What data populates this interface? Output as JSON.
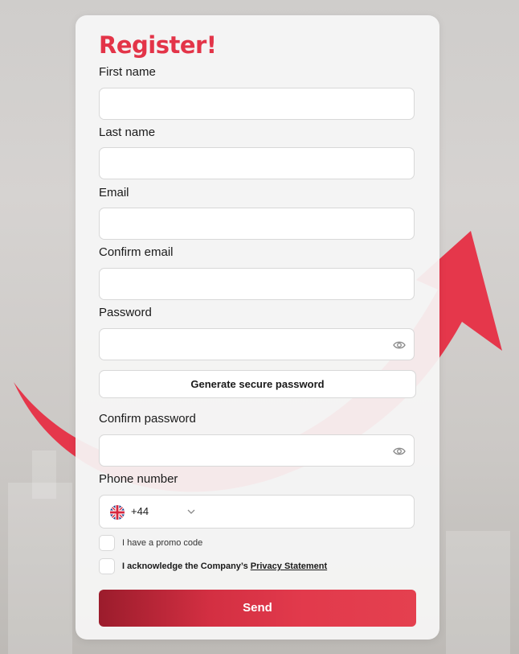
{
  "form": {
    "title": "Register!",
    "first_name_label": "First name",
    "last_name_label": "Last name",
    "email_label": "Email",
    "confirm_email_label": "Confirm email",
    "password_label": "Password",
    "generate_password_label": "Generate secure password",
    "confirm_password_label": "Confirm password",
    "phone_label": "Phone number",
    "phone_dial_code": "+44",
    "promo_label": "I have a promo code",
    "ack_prefix": "I acknowledge the Company’s ",
    "ack_link": "Privacy Statement",
    "send_label": "Send"
  },
  "icons": {
    "password_toggle": "eye-icon",
    "confirm_password_toggle": "eye-icon",
    "country_flag": "uk-flag-icon",
    "country_dropdown": "chevron-down-icon"
  },
  "colors": {
    "accent": "#e33448",
    "button_gradient_start": "#9b1c2c",
    "button_gradient_end": "#e4404f"
  }
}
